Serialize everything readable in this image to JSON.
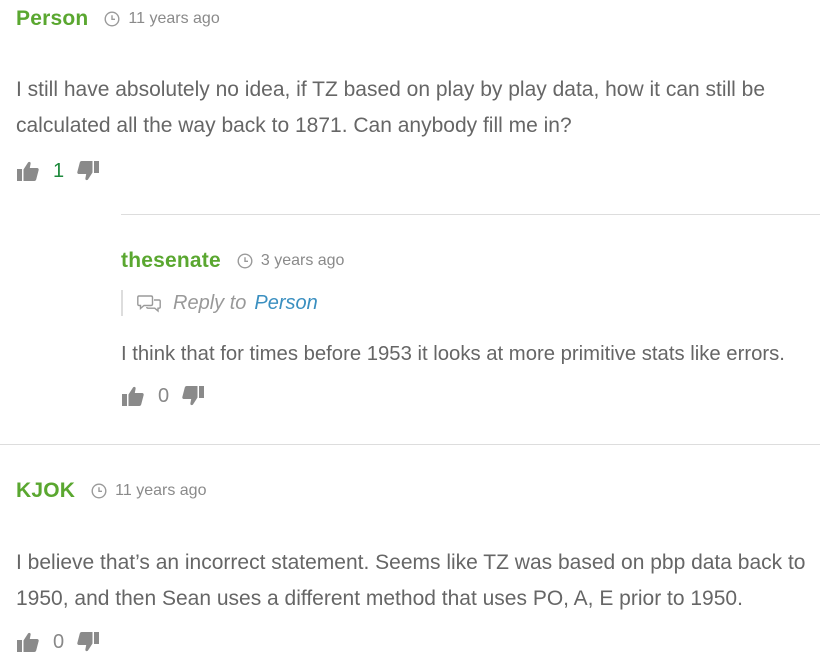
{
  "comments": [
    {
      "author": "Person",
      "time": "11 years ago",
      "text": "I still have absolutely no idea, if TZ based on play by play data, how it can still be calculated all the way back to 1871. Can anybody fill me in?",
      "votes": "1"
    },
    {
      "author": "thesenate",
      "time": "3 years ago",
      "reply_label": "Reply to",
      "reply_to": "Person",
      "text": "I think that for times before 1953 it looks at more primitive stats like errors.",
      "votes": "0"
    },
    {
      "author": "KJOK",
      "time": "11 years ago",
      "text": "I believe that’s an incorrect statement. Seems like TZ was based on pbp data back to 1950, and then Sean uses a different method that uses PO, A, E prior to 1950.",
      "votes": "0"
    }
  ],
  "icons": {
    "clock": "clock-icon",
    "thumbs_up": "thumbs-up-icon",
    "thumbs_down": "thumbs-down-icon",
    "reply": "speech-bubbles-icon"
  },
  "colors": {
    "author": "#5aa730",
    "text": "#666666",
    "meta": "#8a8a8a",
    "link": "#3a8fc0",
    "positive_votes": "#1e8a3c",
    "divider": "#dddddd"
  }
}
